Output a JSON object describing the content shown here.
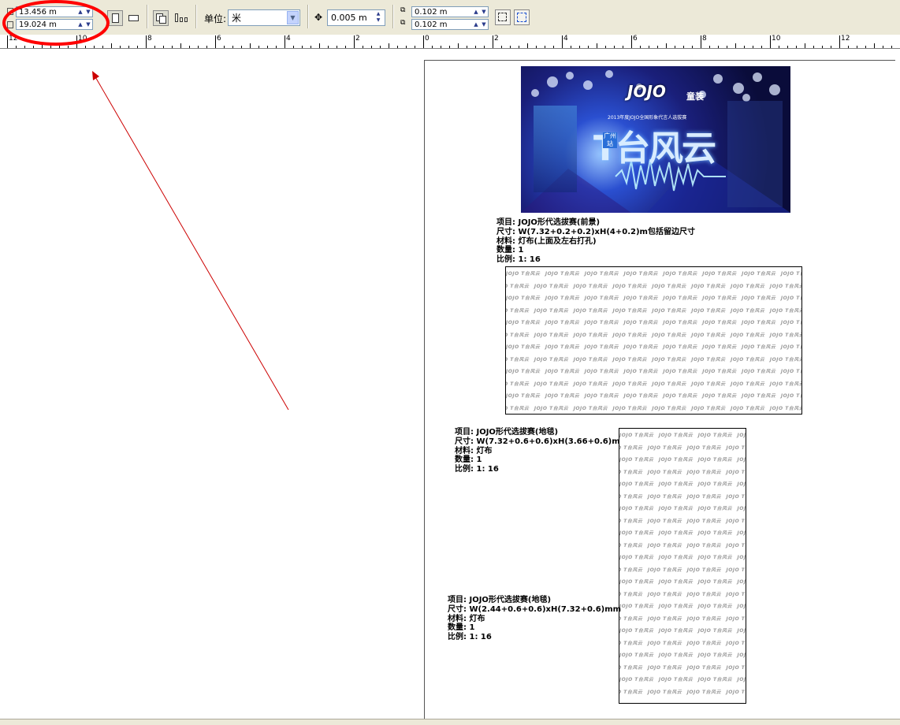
{
  "toolbar": {
    "width_value": "13.456 m",
    "height_value": "19.024 m",
    "units_label": "单位:",
    "units_value": "米",
    "nudge_value": "0.005 m",
    "dup_x_value": "0.102 m",
    "dup_y_value": "0.102 m",
    "spin_up": "▲",
    "spin_down": "▼",
    "drop_arrow": "▼",
    "portrait_icon": "portrait-page-icon",
    "landscape_icon": "landscape-page-icon",
    "all_pages_icon": "all-pages-icon",
    "current_page_icon": "current-page-icon",
    "nudge_icon": "nudge-move-icon",
    "dup_x_icon": "duplicate-distance-x-icon",
    "dup_y_icon": "duplicate-distance-y-icon",
    "treat_as_filled_icon": "treat-as-filled-icon",
    "snap_icon": "snap-to-objects-icon"
  },
  "ruler": {
    "labels": [
      "12",
      "10",
      "8",
      "6",
      "4",
      "2",
      "0",
      "2",
      "4",
      "6",
      "8",
      "10",
      "12"
    ]
  },
  "banner": {
    "logo": "JOJO",
    "logo_sub": "童装",
    "headline": "2013年度JOJO全国形象代言人选拔赛",
    "big_title": "T台风云",
    "city": "广州站"
  },
  "captions": {
    "c1": {
      "line1": "项目: JOJO形代选拔赛(前景)",
      "line2": "尺寸: W(7.32+0.2+0.2)xH(4+0.2)m包括留边尺寸",
      "line3": "材料: 灯布(上面及左右打孔)",
      "line4": "数量: 1",
      "line5": "比例: 1: 16"
    },
    "c2": {
      "line1": "项目: JOJO形代选拔赛(地毯)",
      "line2": "尺寸: W(7.32+0.6+0.6)xH(3.66+0.6)m",
      "line3": "材料: 灯布",
      "line4": "数量: 1",
      "line5": "比例: 1: 16"
    },
    "c3": {
      "line1": "项目: JOJO形代选拔赛(地毯)",
      "line2": "尺寸: W(2.44+0.6+0.6)xH(7.32+0.6)mm",
      "line3": "材料: 灯布",
      "line4": "数量: 1",
      "line5": "比例: 1: 16"
    }
  },
  "pattern_text": "JOJO T台风云",
  "colors": {
    "annotation_red": "#ff0000",
    "toolbar_bg": "#ece9d8"
  }
}
